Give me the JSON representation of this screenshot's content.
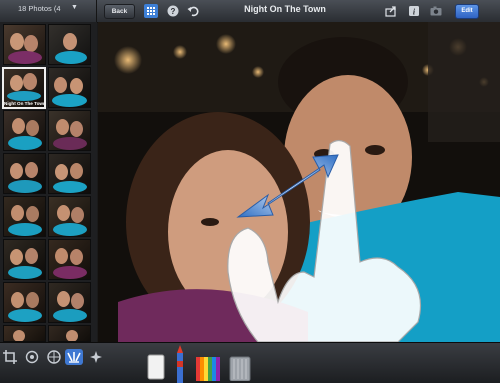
{
  "topbar": {
    "album_count": "18 Photos (4",
    "album_chevron": "▼",
    "back_label": "Back",
    "title": "Night On The Town",
    "edit_label": "Edit"
  },
  "sidebar": {
    "selected_caption": "Night On The Town"
  },
  "icons": {
    "grid": "grid-icon",
    "help": "help-icon",
    "undo": "undo-icon",
    "share": "share-icon",
    "info": "info-icon",
    "camera": "camera-icon",
    "crop": "crop-icon",
    "exposure": "exposure-icon",
    "color": "color-icon",
    "brushes": "brushes-icon",
    "effects": "effects-icon"
  },
  "colors": {
    "accent": "#3d7fd6",
    "edit_button": "#3f73d6"
  }
}
